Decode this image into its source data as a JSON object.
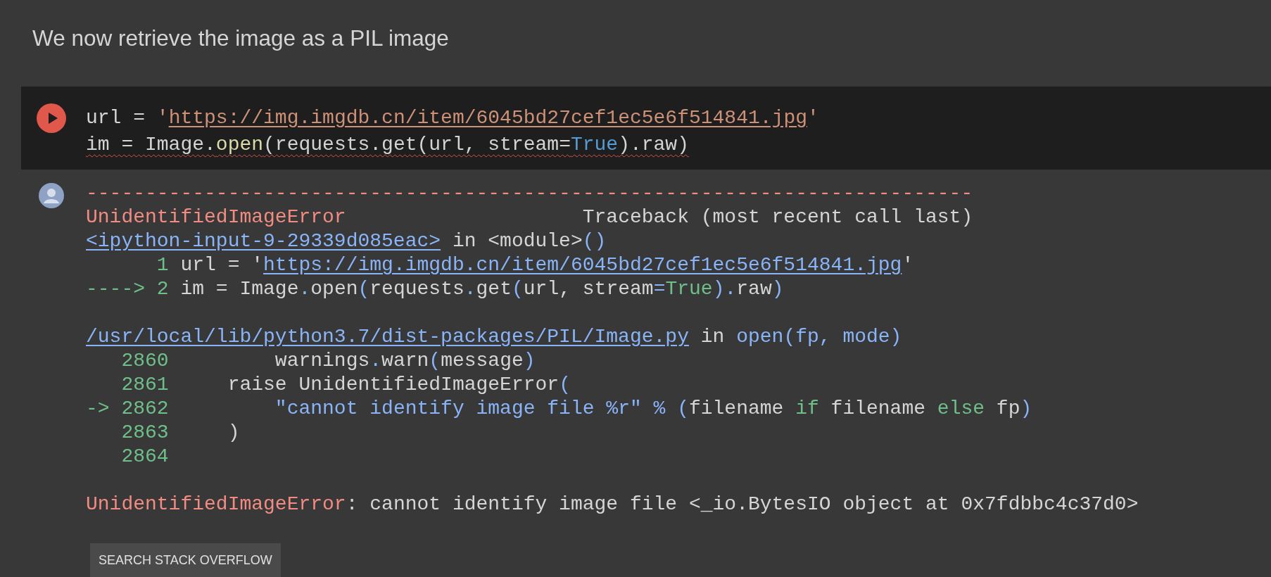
{
  "text_cell": {
    "text": "We now retrieve the image as a PIL image"
  },
  "code_cell": {
    "lines": [
      {
        "error_underline": false,
        "tokens": [
          {
            "text": "url = ",
            "kind": "plain"
          },
          {
            "text": "'",
            "kind": "str"
          },
          {
            "text": "https://img.imgdb.cn/item/6045bd27cef1ec5e6f514841.jpg",
            "kind": "link"
          },
          {
            "text": "'",
            "kind": "str"
          }
        ]
      },
      {
        "error_underline": true,
        "tokens": [
          {
            "text": "im = Image.",
            "kind": "plain"
          },
          {
            "text": "open",
            "kind": "fn"
          },
          {
            "text": "(requests.get(url, stream=",
            "kind": "plain"
          },
          {
            "text": "True",
            "kind": "const"
          },
          {
            "text": ").raw)",
            "kind": "plain"
          }
        ]
      }
    ]
  },
  "output": {
    "blocks": [
      {
        "lines": [
          [
            {
              "text": "---------------------------------------------------------------------------",
              "kind": "err"
            }
          ],
          [
            {
              "text": "UnidentifiedImageError",
              "kind": "err"
            },
            {
              "text": "                    Traceback (most recent call last)",
              "kind": "plain"
            }
          ],
          [
            {
              "text": "<ipython-input-9-29339d085eac>",
              "kind": "link"
            },
            {
              "text": " in <module>",
              "kind": "plain"
            },
            {
              "text": "()",
              "kind": "punct"
            }
          ],
          [
            {
              "text": "      1",
              "kind": "num"
            },
            {
              "text": " url = '",
              "kind": "plain"
            },
            {
              "text": "https://img.imgdb.cn/item/6045bd27cef1ec5e6f514841.jpg",
              "kind": "link"
            },
            {
              "text": "'",
              "kind": "plain"
            }
          ],
          [
            {
              "text": "----> 2",
              "kind": "num"
            },
            {
              "text": " im = Image",
              "kind": "plain"
            },
            {
              "text": ".",
              "kind": "punct"
            },
            {
              "text": "open",
              "kind": "plain"
            },
            {
              "text": "(",
              "kind": "punct"
            },
            {
              "text": "requests",
              "kind": "plain"
            },
            {
              "text": ".",
              "kind": "punct"
            },
            {
              "text": "get",
              "kind": "plain"
            },
            {
              "text": "(",
              "kind": "punct"
            },
            {
              "text": "url, stream",
              "kind": "plain"
            },
            {
              "text": "=",
              "kind": "punct"
            },
            {
              "text": "True",
              "kind": "kw"
            },
            {
              "text": ")",
              "kind": "punct"
            },
            {
              "text": ".",
              "kind": "punct"
            },
            {
              "text": "raw",
              "kind": "plain"
            },
            {
              "text": ")",
              "kind": "punct"
            }
          ]
        ]
      },
      {
        "lines": [
          [
            {
              "text": "/usr/local/lib/python3.7/dist-packages/PIL/Image.py",
              "kind": "link"
            },
            {
              "text": " in ",
              "kind": "plain"
            },
            {
              "text": "open(fp, mode)",
              "kind": "punct"
            }
          ],
          [
            {
              "text": "   2860",
              "kind": "num"
            },
            {
              "text": "         warnings",
              "kind": "plain"
            },
            {
              "text": ".",
              "kind": "punct"
            },
            {
              "text": "warn",
              "kind": "plain"
            },
            {
              "text": "(",
              "kind": "punct"
            },
            {
              "text": "message",
              "kind": "plain"
            },
            {
              "text": ")",
              "kind": "punct"
            }
          ],
          [
            {
              "text": "   2861",
              "kind": "num"
            },
            {
              "text": "     raise UnidentifiedImageError",
              "kind": "plain"
            },
            {
              "text": "(",
              "kind": "punct"
            }
          ],
          [
            {
              "text": "-> 2862",
              "kind": "num"
            },
            {
              "text": "         \"cannot identify image file %r\" % (",
              "kind": "punct"
            },
            {
              "text": "filename ",
              "kind": "plain"
            },
            {
              "text": "if",
              "kind": "kw"
            },
            {
              "text": " filename ",
              "kind": "plain"
            },
            {
              "text": "else",
              "kind": "kw"
            },
            {
              "text": " fp",
              "kind": "plain"
            },
            {
              "text": ")",
              "kind": "punct"
            }
          ],
          [
            {
              "text": "   2863",
              "kind": "num"
            },
            {
              "text": "     )",
              "kind": "plain"
            }
          ],
          [
            {
              "text": "   2864",
              "kind": "num"
            }
          ]
        ]
      },
      {
        "lines": [
          [
            {
              "text": "UnidentifiedImageError",
              "kind": "err"
            },
            {
              "text": ": cannot identify image file <_io.BytesIO object at 0x7fdbbc4c37d0>",
              "kind": "plain"
            }
          ]
        ]
      }
    ],
    "button": "SEARCH STACK OVERFLOW"
  }
}
